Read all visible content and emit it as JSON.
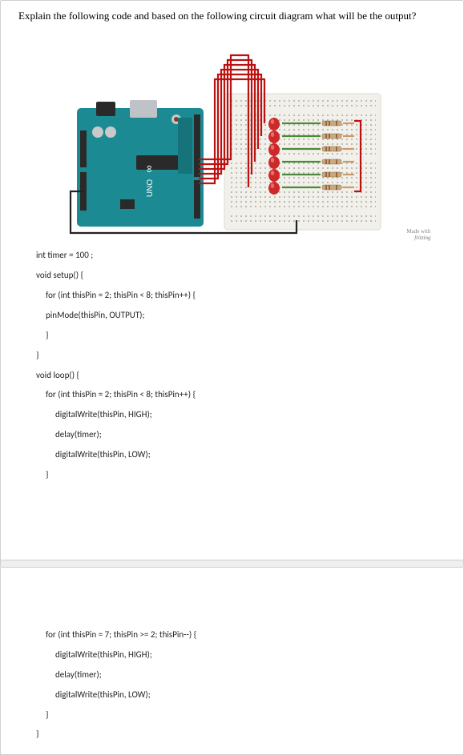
{
  "question": "Explain the following code and based on the following circuit diagram what will be the output?",
  "credit": {
    "made": "Made with",
    "tool": "fritzing"
  },
  "arduino_label_1": "∞",
  "arduino_label_2": "UNO",
  "code": {
    "l01": "int timer = 100 ;",
    "l02": "void setup() {",
    "l03": "for (int thisPin = 2; thisPin < 8; thisPin++) {",
    "l04": "pinMode(thisPin, OUTPUT);",
    "l05": "}",
    "l06": "}",
    "l07": "void loop() {",
    "l08": "for (int thisPin = 2; thisPin < 8; thisPin++) {",
    "l09": "digitalWrite(thisPin, HIGH);",
    "l10": "delay(timer);",
    "l11": "digitalWrite(thisPin, LOW);",
    "l12": "}",
    "l13": "for (int thisPin = 7; thisPin >= 2; thisPin--) {",
    "l14": "digitalWrite(thisPin, HIGH);",
    "l15": "delay(timer);",
    "l16": "digitalWrite(thisPin, LOW);",
    "l17": "}",
    "l18": "}"
  }
}
